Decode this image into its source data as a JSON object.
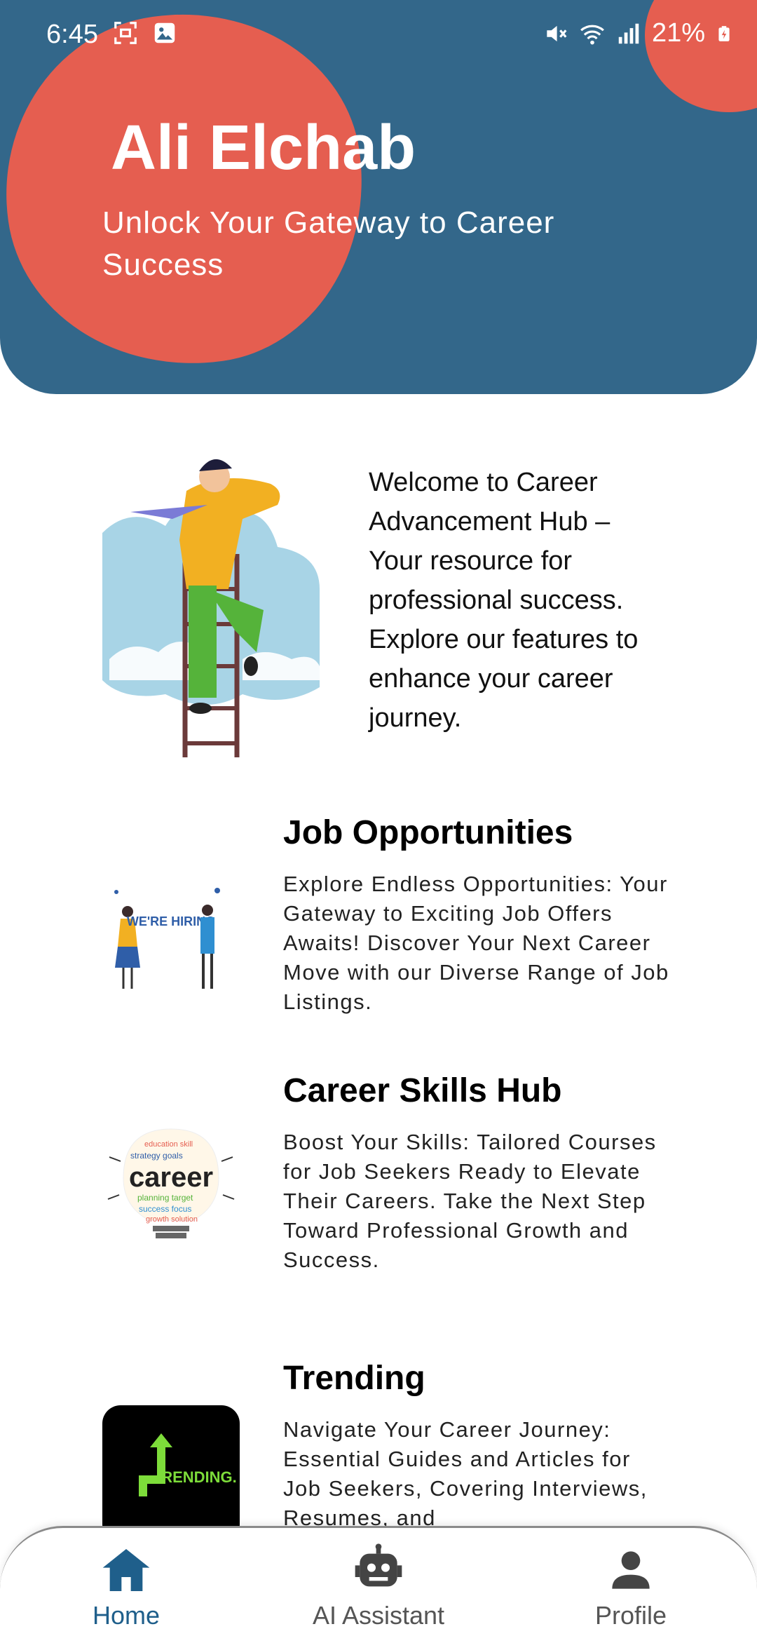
{
  "status": {
    "time": "6:45",
    "battery": "21%"
  },
  "header": {
    "title": "Ali Elchab",
    "subtitle": "Unlock Your Gateway to Career Success"
  },
  "welcome": {
    "text": "Welcome to Career Advancement Hub – Your resource for professional success. Explore our features to enhance your career journey."
  },
  "features": [
    {
      "title": "Job Opportunities",
      "description": "Explore Endless Opportunities: Your Gateway to Exciting Job Offers Awaits! Discover Your Next Career Move with our Diverse Range of Job Listings.",
      "image_text": "WE'RE HIRING"
    },
    {
      "title": "Career Skills Hub",
      "description": "Boost Your Skills: Tailored Courses for Job Seekers Ready to Elevate Their Careers. Take the Next Step Toward Professional Growth and Success.",
      "image_text": "career"
    },
    {
      "title": "Trending",
      "description": "Navigate Your Career Journey: Essential Guides and Articles for Job Seekers, Covering Interviews, Resumes, and",
      "image_text": "RENDING."
    }
  ],
  "nav": {
    "home": "Home",
    "ai": "AI Assistant",
    "profile": "Profile"
  },
  "colors": {
    "header": "#33678a",
    "accent": "#e55e50",
    "nav_active": "#1f5f8b"
  }
}
